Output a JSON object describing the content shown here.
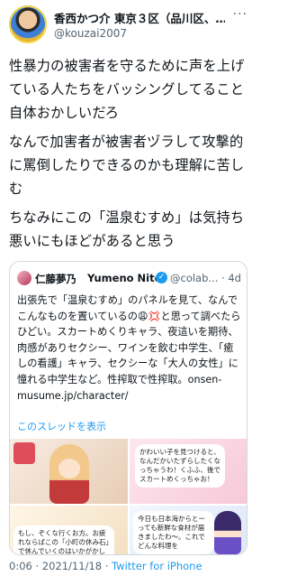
{
  "author": {
    "name": "香西かつ介 東京３区（品川区、…",
    "handle": "@kouzai2007"
  },
  "tweet": {
    "paragraphs": [
      "性暴力の被害者を守るために声を上げている人たちをバッシングしてること自体おかしいだろ",
      "なんで加害者が被害者ヅラして攻撃的に罵倒したりできるのかも理解に苦しむ",
      "ちなみにこの「温泉むすめ」は気持ち悪いにもほどがあると思う"
    ]
  },
  "quote": {
    "name_jp": "仁藤夢乃",
    "name_en": "Yumeno Nito",
    "handle": "@colab... · 4d",
    "text": "出張先で「温泉むすめ」のパネルを見て、なんでこんなものを置いているの😩💢と思って調べたらひどい。スカートめくりキャラ、夜這いを期待、肉感がありセクシー、ワインを飲む中学生、「癒しの看護」キャラ、セクシーな「大人の女性」に憧れる中学生など。性搾取で性搾取。onsen-musume.jp/character/",
    "show_thread": "このスレッドを表示",
    "media": {
      "tile2_text": "かわいい子を見つけると、なんだかいたずらしたくなっちゃうわ！くふふ、後でスカートめくっちゃお！",
      "tile3_text": "もし、ぞくな行くお方。お疲れならばこの「小町の休み石」で休んでいくのはいかがかしら？",
      "tile4_text": "今日も日本海からとーっても新鮮な食材が届きましたわ〜。これでどんな料理を"
    }
  },
  "footer": {
    "time": "0:06 · 2021/11/18 · ",
    "source": "Twitter for iPhone"
  },
  "colors": {
    "accent": "#1d9bf0",
    "secondary_text": "#536471",
    "border": "#cfd9de"
  },
  "icons": [
    "verified-badge-icon",
    "more-options-icon"
  ]
}
